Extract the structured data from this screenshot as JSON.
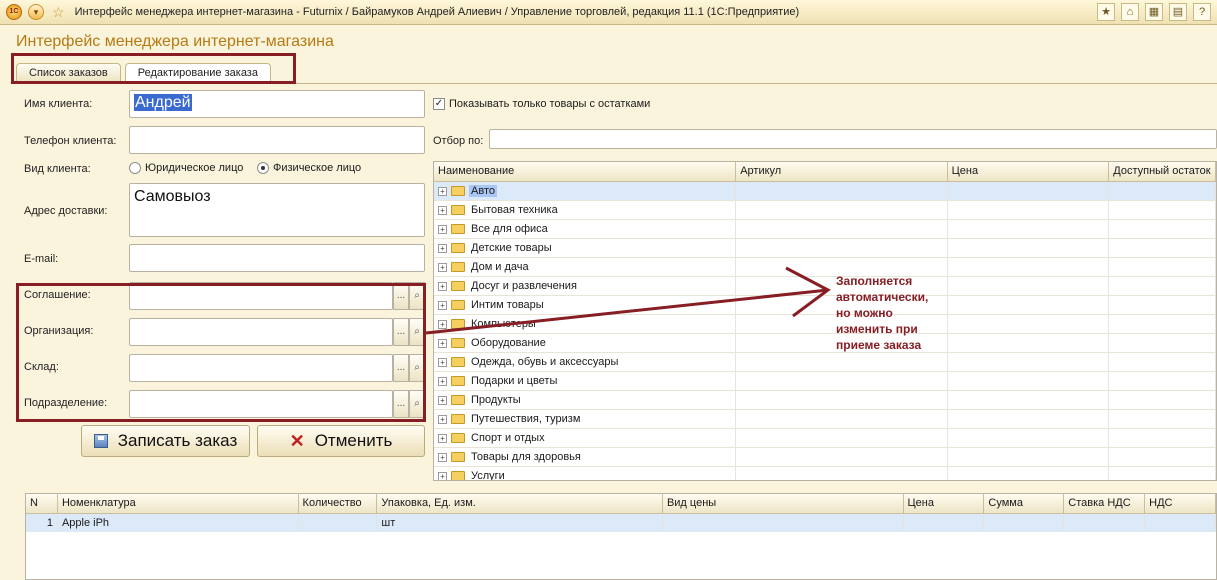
{
  "window": {
    "title": "Интерфейс менеджера интернет-магазина - Futurnix / Байрамуков Андрей Алиевич / Управление торговлей, редакция 11.1  (1С:Предприятие)",
    "logo_text": "1С"
  },
  "page_title": "Интерфейс менеджера интернет-магазина",
  "tabs": [
    {
      "label": "Список заказов"
    },
    {
      "label": "Редактирование заказа"
    }
  ],
  "form": {
    "client_name_label": "Имя клиента:",
    "client_name_value": "Андрей",
    "phone_label": "Телефон клиента:",
    "client_type_label": "Вид клиента:",
    "client_type_options": [
      "Юридическое лицо",
      "Физическое лицо"
    ],
    "client_type_selected": "Физическое лицо",
    "address_label": "Адрес доставки:",
    "address_value": "Самовыоз",
    "email_label": "E-mail:",
    "agreement_label": "Соглашение:",
    "organization_label": "Организация:",
    "warehouse_label": "Склад:",
    "division_label": "Подразделение:",
    "ellipsis": "...",
    "save_button": "Записать заказ",
    "cancel_button": "Отменить"
  },
  "filter": {
    "stock_only_label": "Показывать только товары с остатками",
    "stock_only_checked": true,
    "selection_label": "Отбор по:"
  },
  "products": {
    "columns": [
      "Наименование",
      "Артикул",
      "Цена",
      "Доступный остаток"
    ],
    "rows": [
      "Авто",
      "Бытовая техника",
      "Все для офиса",
      "Детские товары",
      "Дом и дача",
      "Досуг и развлечения",
      "Интим товары",
      "Компьютеры",
      "Оборудование",
      "Одежда, обувь и аксессуары",
      "Подарки и цветы",
      "Продукты",
      "Путешествия, туризм",
      "Спорт и отдых",
      "Товары для здоровья",
      "Услуги"
    ],
    "selected_index": 0
  },
  "order_table": {
    "columns": [
      "N",
      "Номенклатура",
      "Количество",
      "Упаковка, Ед. изм.",
      "Вид цены",
      "Цена",
      "Сумма",
      "Ставка НДС",
      "НДС"
    ],
    "rows": [
      {
        "n": "1",
        "item": "Apple iPh",
        "unit": "шт"
      }
    ]
  },
  "annotation": "Заполняется\nавтоматически,\nно можно\nизменить при\nприеме заказа",
  "colors": {
    "highlight": "#861e24",
    "title_accent": "#b57a14",
    "background": "#fbf4dd"
  }
}
